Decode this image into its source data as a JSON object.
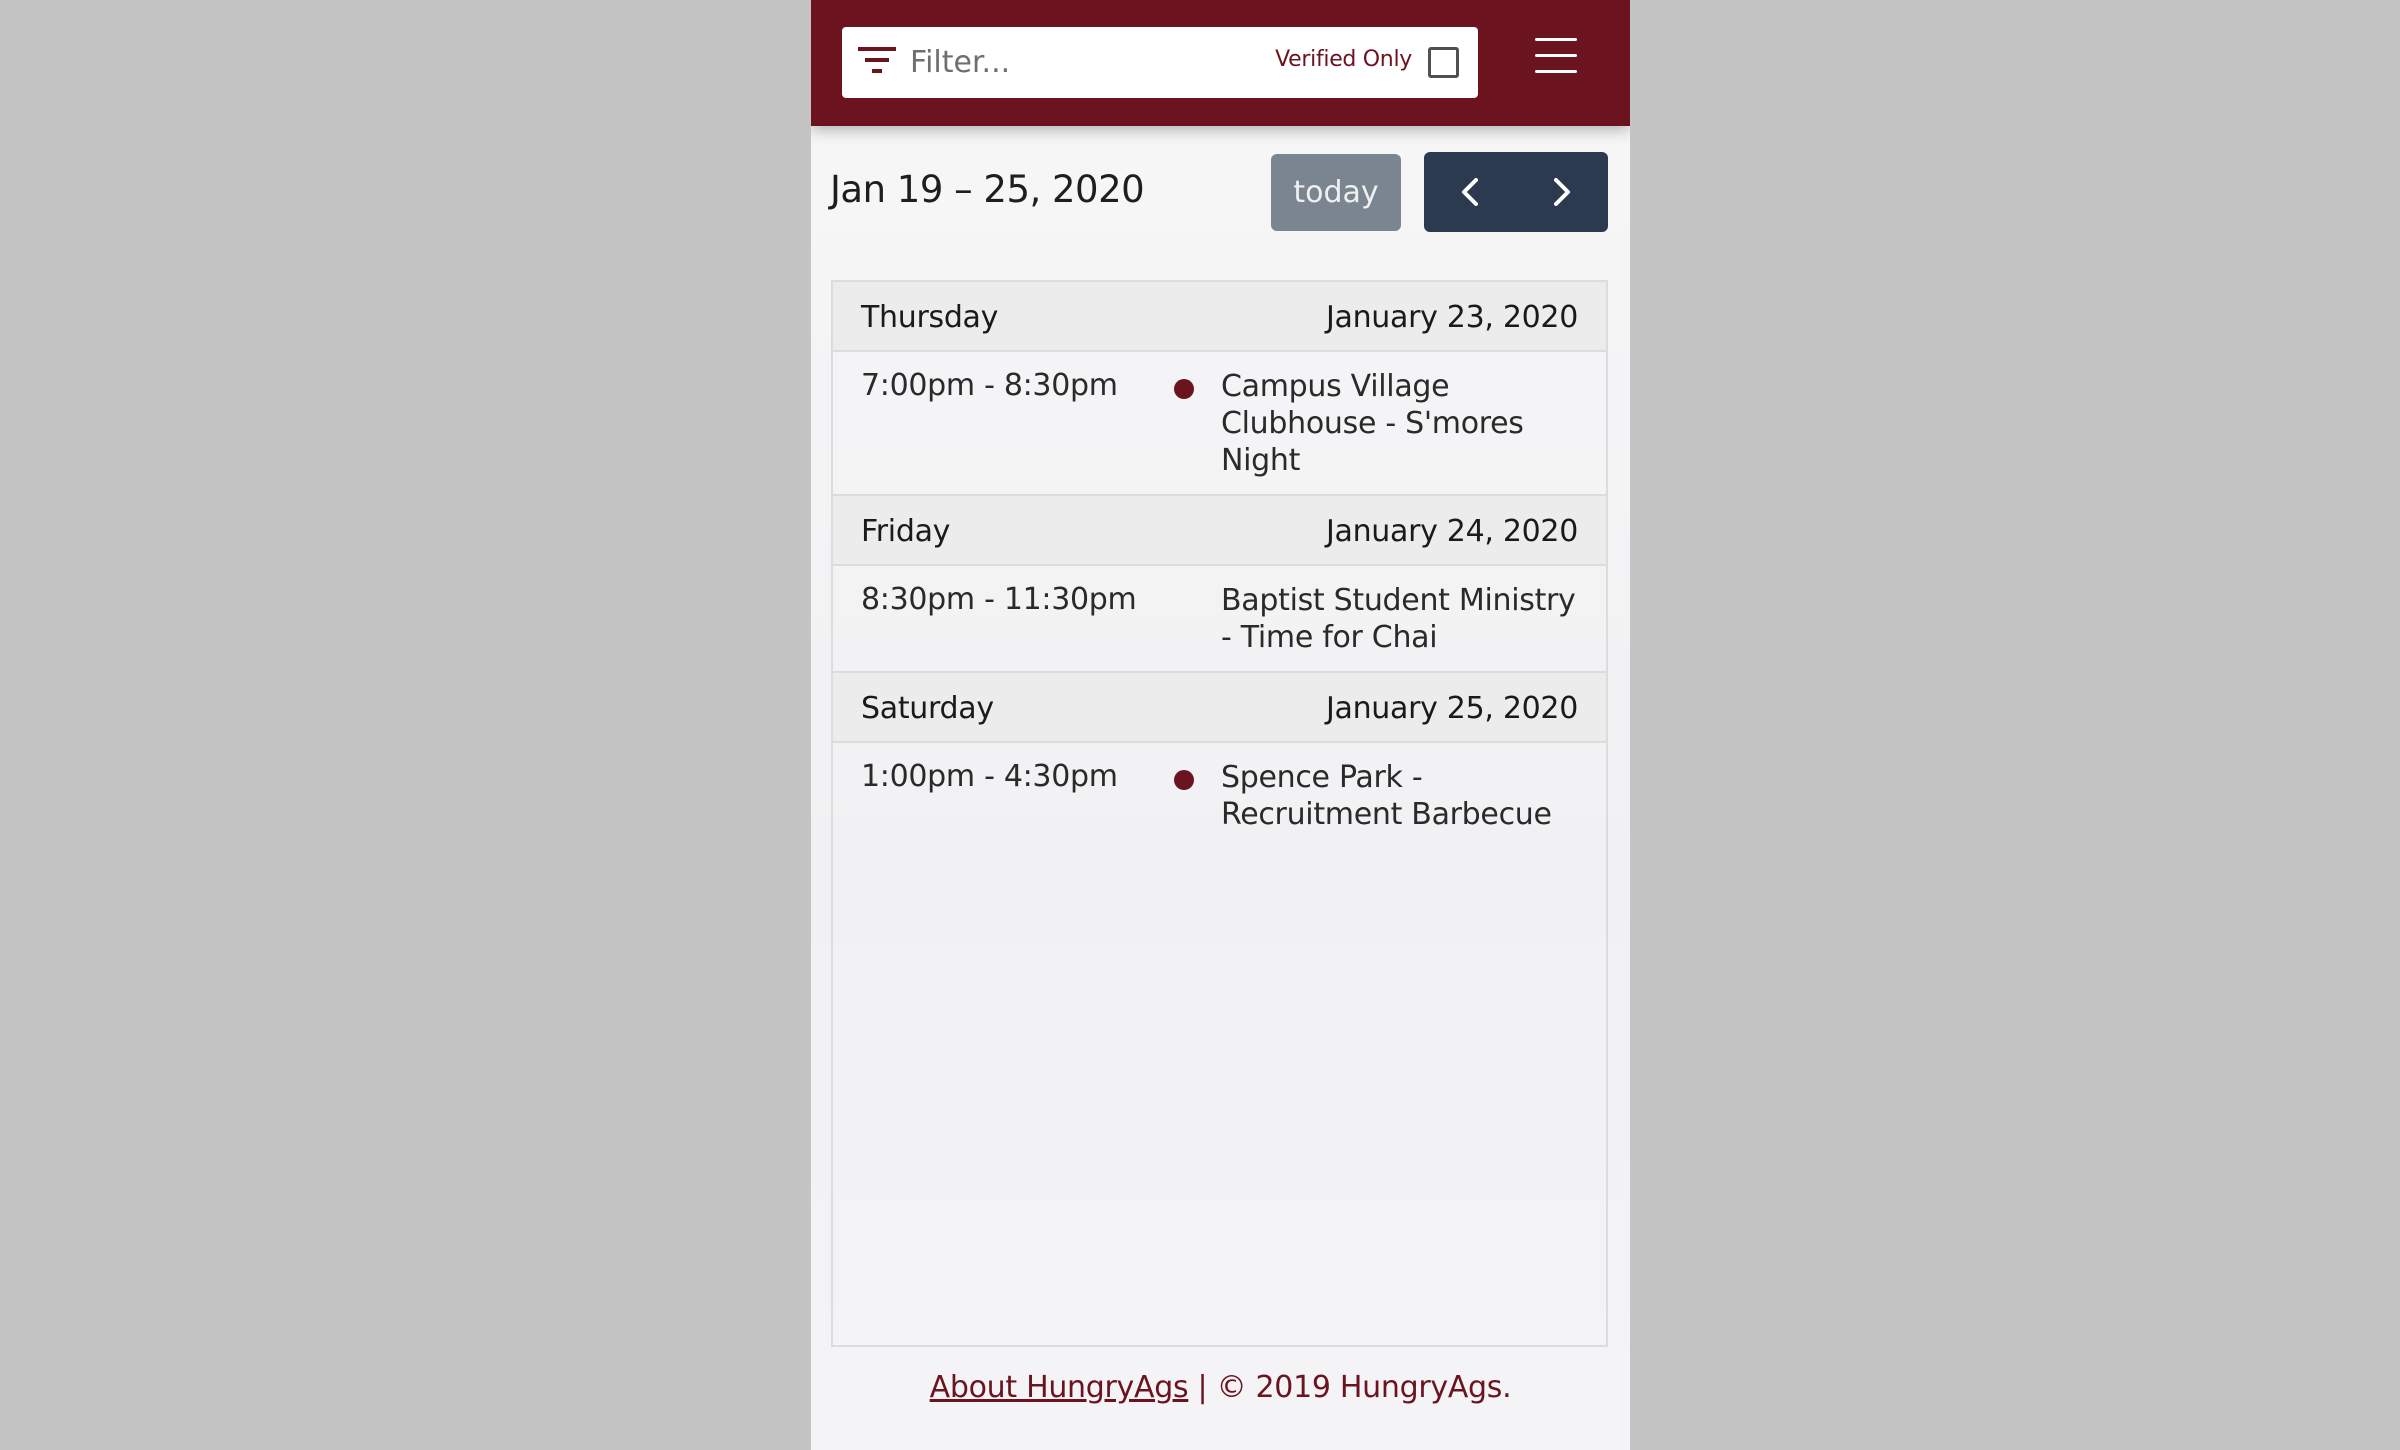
{
  "colors": {
    "brand": "#6b1420",
    "nav_button": "#2b3a4e",
    "today_button": "#7a8590",
    "event_dot": "#6b1420"
  },
  "header": {
    "filter": {
      "icon": "filter-icon",
      "placeholder": "Filter...",
      "value": ""
    },
    "verified_only": {
      "label": "Verified Only",
      "checked": false
    },
    "menu_icon": "hamburger-menu-icon"
  },
  "toolbar": {
    "range_title": "Jan 19 – 25, 2020",
    "today_label": "today",
    "prev_icon": "chevron-left-icon",
    "next_icon": "chevron-right-icon"
  },
  "days": [
    {
      "name": "Thursday",
      "date": "January 23, 2020",
      "events": [
        {
          "time": "7:00pm - 8:30pm",
          "title": "Campus Village Clubhouse - S'mores Night",
          "dot": true
        }
      ]
    },
    {
      "name": "Friday",
      "date": "January 24, 2020",
      "events": [
        {
          "time": "8:30pm - 11:30pm",
          "title": "Baptist Student Ministry - Time for Chai",
          "dot": false
        }
      ]
    },
    {
      "name": "Saturday",
      "date": "January 25, 2020",
      "events": [
        {
          "time": "1:00pm - 4:30pm",
          "title": "Spence Park - Recruitment Barbecue",
          "dot": true
        }
      ]
    }
  ],
  "footer": {
    "about_link": "About HungryAgs",
    "copyright": " | © 2019 HungryAgs."
  }
}
